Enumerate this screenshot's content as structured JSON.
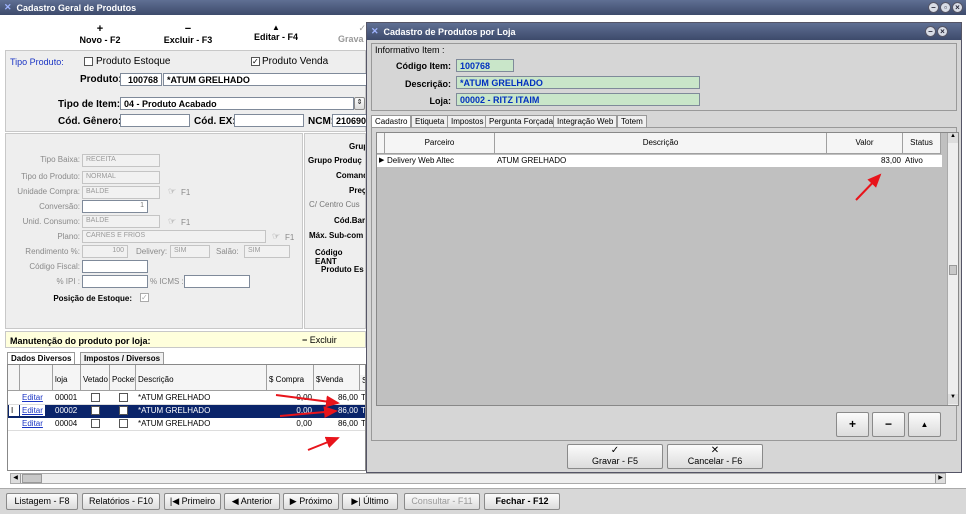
{
  "main_window": {
    "title": "Cadastro Geral de Produtos"
  },
  "toolbar": {
    "new_label": "Novo - F2",
    "delete_label": "Excluir - F3",
    "edit_label": "Editar - F4",
    "save_label": "Grava"
  },
  "product": {
    "tipo_label": "Tipo Produto:",
    "estoque_label": "Produto Estoque",
    "venda_label": "Produto Venda",
    "produto_label": "Produto:",
    "code": "100768",
    "name": "*ATUM GRELHADO",
    "tipo_item_label": "Tipo de Item:",
    "tipo_item_value": "04 - Produto Acabado",
    "genero_label": "Cód. Gênero:",
    "ex_label": "Cód. EX:",
    "ncm_label": "NCM:",
    "ncm_value": "2106909"
  },
  "left_fields": {
    "tipo_baixa": {
      "label": "Tipo Baixa:",
      "value": "RECEITA"
    },
    "tipo_produto": {
      "label": "Tipo do Produto:",
      "value": "NORMAL"
    },
    "unidade_compra": {
      "label": "Unidade Compra:",
      "value": "BALDE"
    },
    "conversao": {
      "label": "Conversão:",
      "value": "1"
    },
    "unid_consumo": {
      "label": "Unid. Consumo:",
      "value": "BALDE"
    },
    "plano": {
      "label": "Plano:",
      "value": "CARNES E FRIOS"
    },
    "rendimento": {
      "label": "Rendimento %:",
      "value": "100"
    },
    "delivery": {
      "label": "Delivery:",
      "value": "SIM"
    },
    "salao": {
      "label": "Salão:",
      "value": "SIM"
    },
    "codigo_fiscal": {
      "label": "Código Fiscal:"
    },
    "ipi": {
      "label": "% IPI :"
    },
    "icms": {
      "label": "% ICMS :"
    },
    "posicao_estoque": {
      "label": "Posição de Estoque:"
    },
    "f1": "F1"
  },
  "right_fields": [
    "Grup",
    "Grupo Produç",
    "Comand",
    "Preç",
    "C/ Centro Cus",
    "Cód.Bar",
    "Máx. Sub-com",
    "Código EANT",
    "Produto Es"
  ],
  "store_section": {
    "title": "Manutenção do produto por loja:",
    "excluir": "Excluir",
    "tabs": [
      "Dados Diversos",
      "Impostos / Diversos"
    ],
    "columns": [
      "loja",
      "Vetado",
      "Pocket",
      "Descrição",
      "$ Compra",
      "$Venda",
      "S"
    ],
    "rows": [
      {
        "action": "Editar",
        "loja": "00001",
        "descricao": "*ATUM GRELHADO",
        "compra": "0,00",
        "venda": "86,00",
        "s": "T"
      },
      {
        "action": "Editar",
        "loja": "00002",
        "descricao": "*ATUM GRELHADO",
        "compra": "0,00",
        "venda": "86,00",
        "s": "T"
      },
      {
        "action": "Editar",
        "loja": "00004",
        "descricao": "*ATUM GRELHADO",
        "compra": "0,00",
        "venda": "86,00",
        "s": "T"
      }
    ]
  },
  "bottom_bar": {
    "listagem": "Listagem - F8",
    "relatorios": "Relatórios - F10",
    "primeiro": "Primeiro",
    "anterior": "Anterior",
    "proximo": "Próximo",
    "ultimo": "Último",
    "consultar": "Consultar - F11",
    "fechar": "Fechar - F12"
  },
  "dialog": {
    "title": "Cadastro de Produtos por Loja",
    "info_title": "Informativo Item :",
    "codigo_label": "Código Item:",
    "codigo": "100768",
    "descricao_label": "Descrição:",
    "descricao": "*ATUM GRELHADO",
    "loja_label": "Loja:",
    "loja": "00002 - RITZ ITAIM",
    "tabs": [
      "Cadastro",
      "Etiqueta",
      "Impostos",
      "Pergunta Forçada",
      "Integração Web",
      "Totem"
    ],
    "columns": [
      "Parceiro",
      "Descrição",
      "Valor",
      "Status"
    ],
    "rows": [
      {
        "parceiro": "Delivery Web Altec",
        "descricao": "ATUM GRELHADO",
        "valor": "83,00",
        "status": "Ativo"
      }
    ],
    "gravar": "Gravar - F5",
    "cancelar": "Cancelar - F6"
  },
  "colors": {
    "titlebar": "#3d4a6b",
    "dialog_bg": "#d6d6d6",
    "readonly_field": "#c9e6c9",
    "selected_row": "#0a246a",
    "arrow": "#e8141b"
  }
}
